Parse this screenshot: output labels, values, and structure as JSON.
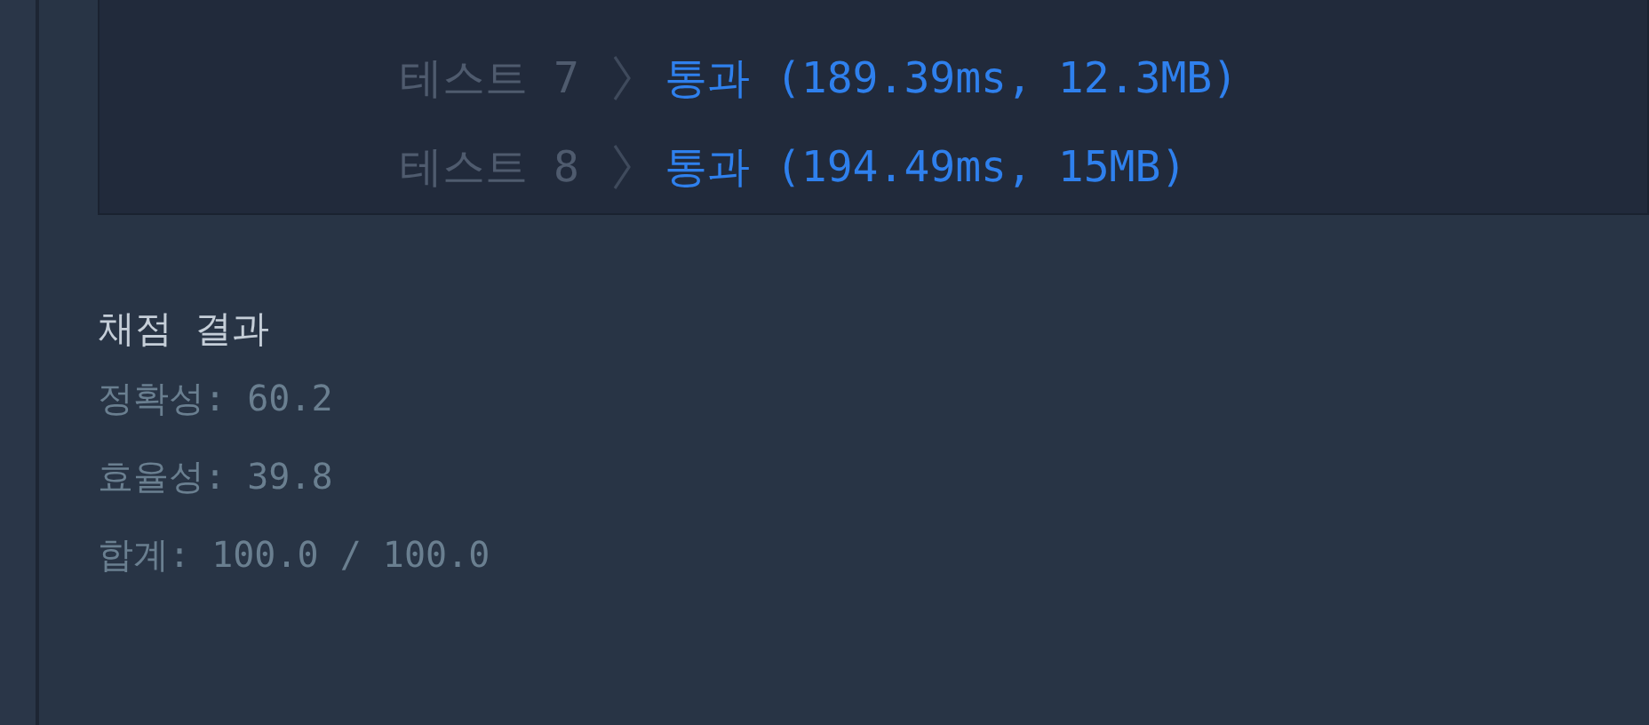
{
  "test_results": [
    {
      "label": "테스트 7",
      "result": "통과 (189.39ms, 12.3MB)"
    },
    {
      "label": "테스트 8",
      "result": "통과 (194.49ms, 15MB)"
    }
  ],
  "grading": {
    "title": "채점 결과",
    "lines": [
      "정확성: 60.2",
      "효율성: 39.8",
      "합계: 100.0 / 100.0"
    ]
  }
}
